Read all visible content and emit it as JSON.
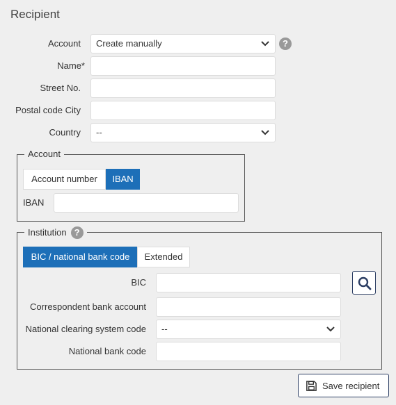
{
  "title": "Recipient",
  "form": {
    "account_label": "Account",
    "account_value": "Create manually",
    "name_label": "Name*",
    "street_label": "Street No.",
    "postal_label": "Postal code City",
    "country_label": "Country",
    "country_value": "--"
  },
  "account_group": {
    "legend": "Account",
    "tabs": [
      "Account number",
      "IBAN"
    ],
    "active_tab": "IBAN",
    "iban_label": "IBAN"
  },
  "institution_group": {
    "legend": "Institution",
    "tabs": [
      "BIC / national bank code",
      "Extended"
    ],
    "active_tab": "BIC / national bank code",
    "bic_label": "BIC",
    "correspondent_label": "Correspondent bank account",
    "clearing_label": "National clearing system code",
    "clearing_value": "--",
    "bank_code_label": "National bank code"
  },
  "save_label": "Save recipient",
  "help_glyph": "?",
  "colors": {
    "accent": "#1d6fb8",
    "background": "#efefef",
    "help_icon": "#999999"
  }
}
